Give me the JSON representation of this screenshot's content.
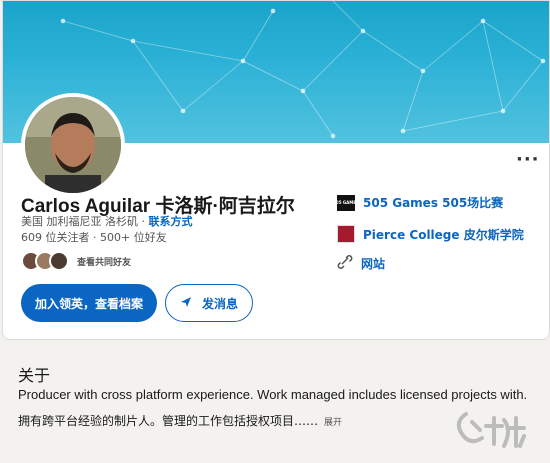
{
  "profile": {
    "name": "Carlos Aguilar   卡洛斯·阿吉拉尔",
    "location": "美国 加利福尼亚 洛杉矶 · ",
    "contact_link": "联系方式",
    "stats": "609 位关注者 · 500+ 位好友",
    "mutual_text": "查看共同好友",
    "more_label": "···"
  },
  "actions": {
    "primary": "加入领英，查看档案",
    "message": "发消息"
  },
  "affiliations": [
    {
      "name": "505 Games   505场比赛",
      "logo_text": "505 GAMES"
    },
    {
      "name": "Pierce College   皮尔斯学院"
    },
    {
      "name": "网站"
    }
  ],
  "about": {
    "title": "关于",
    "text_en": "Producer with cross platform experience. Work managed includes licensed projects with...",
    "text_zh": "拥有跨平台经验的制片人。管理的工作包括授权项目……",
    "expand": "展开"
  },
  "watermark": {
    "text": "九游"
  },
  "colors": {
    "accent": "#0a66c2",
    "banner": "#2bb1d6"
  }
}
